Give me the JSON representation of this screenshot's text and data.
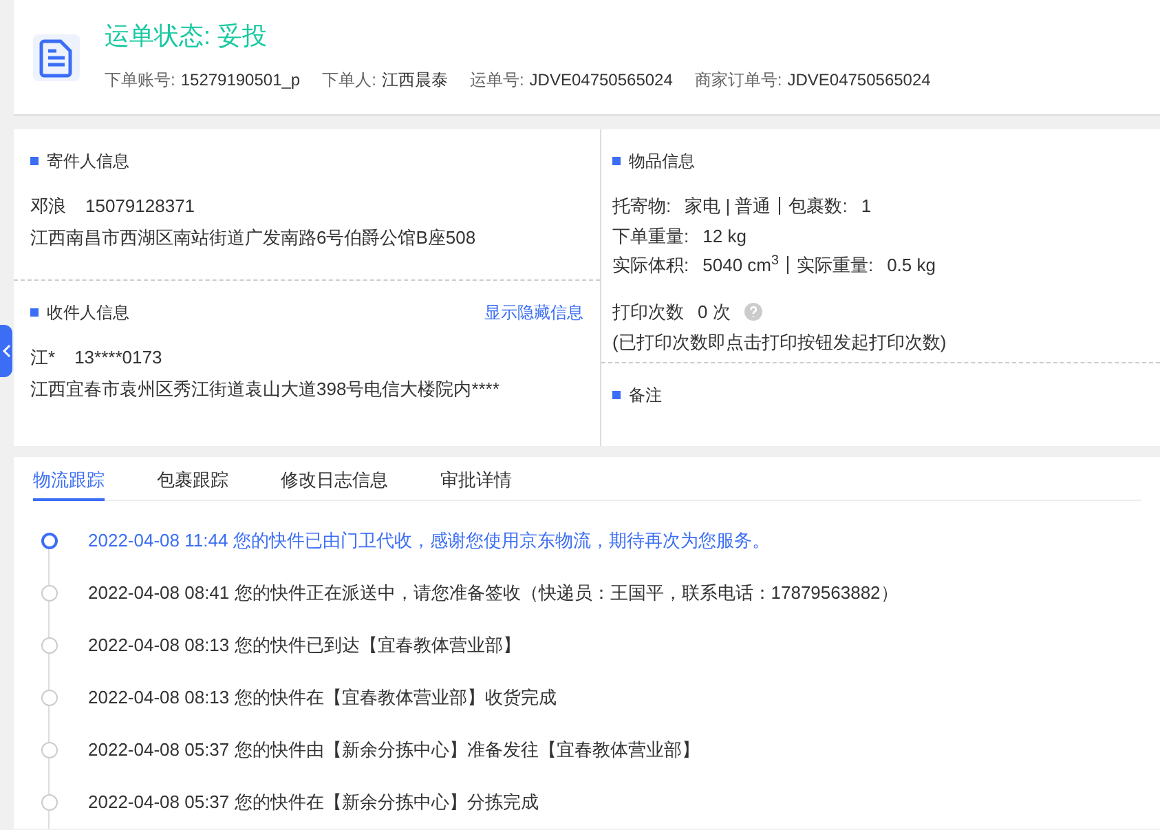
{
  "header": {
    "status": "运单状态: 妥投",
    "fields": [
      {
        "label": "下单账号:",
        "value": "15279190501_p"
      },
      {
        "label": "下单人:",
        "value": "江西晨泰"
      },
      {
        "label": "运单号:",
        "value": "JDVE04750565024"
      },
      {
        "label": "商家订单号:",
        "value": "JDVE04750565024"
      }
    ]
  },
  "sender": {
    "title": "寄件人信息",
    "name": "邓浪",
    "phone": "15079128371",
    "address": "江西南昌市西湖区南站街道广发南路6号伯爵公馆B座508"
  },
  "recipient": {
    "title": "收件人信息",
    "link": "显示隐藏信息",
    "name": "江*",
    "phone": "13****0173",
    "address": "江西宜春市袁州区秀江街道袁山大道398号电信大楼院内****"
  },
  "goods": {
    "title": "物品信息",
    "lines": [
      [
        {
          "label": "托寄物:",
          "value": "家电 | 普通"
        },
        {
          "label": "包裹数:",
          "value": "1"
        }
      ],
      [
        {
          "label": "下单重量:",
          "value": "12 kg"
        }
      ],
      [
        {
          "label": "实际体积:",
          "value": "5040 cm$^{3}$"
        },
        {
          "label": "实际重量:",
          "value": "0.5 kg"
        }
      ]
    ],
    "print_label": "打印次数",
    "print_value": "0 次",
    "print_note": "(已打印次数即点击打印按钮发起打印次数)"
  },
  "remarks": {
    "title": "备注"
  },
  "tabs": [
    {
      "label": "物流跟踪",
      "selected": true
    },
    {
      "label": "包裹跟踪",
      "selected": false
    },
    {
      "label": "修改日志信息",
      "selected": false
    },
    {
      "label": "审批详情",
      "selected": false
    }
  ],
  "events": [
    {
      "text": "2022-04-08 11:44 您的快件已由门卫代收，感谢您使用京东物流，期待再次为您服务。",
      "current": true
    },
    {
      "text": "2022-04-08 08:41 您的快件正在派送中，请您准备签收（快递员：王国平，联系电话：17879563882）",
      "current": false
    },
    {
      "text": "2022-04-08 08:13 您的快件已到达【宜春教体营业部】",
      "current": false
    },
    {
      "text": "2022-04-08 08:13 您的快件在【宜春教体营业部】收货完成",
      "current": false
    },
    {
      "text": "2022-04-08 05:37 您的快件由【新余分拣中心】准备发往【宜春教体营业部】",
      "current": false
    },
    {
      "text": "2022-04-08 05:37 您的快件在【新余分拣中心】分拣完成",
      "current": false
    }
  ]
}
